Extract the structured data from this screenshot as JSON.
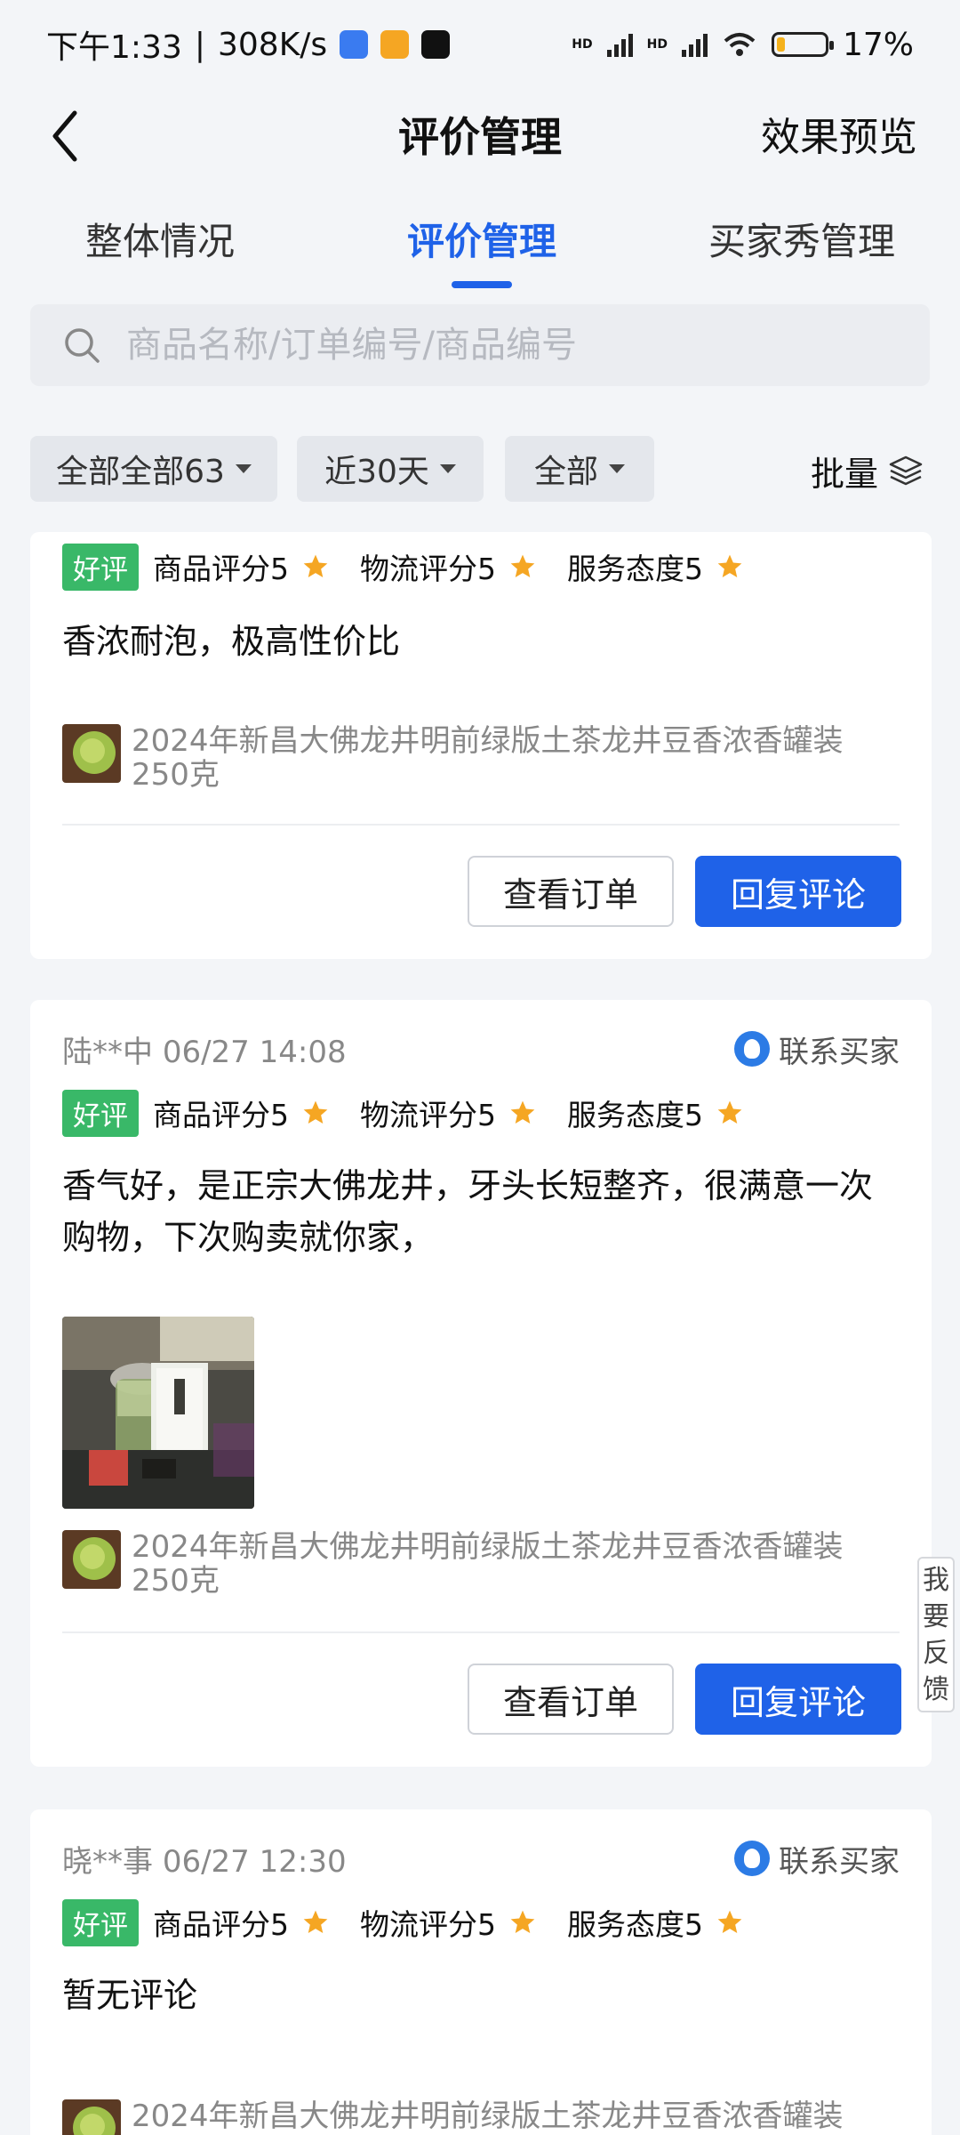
{
  "status_bar": {
    "time": "下午1:33",
    "speed": "308K/s",
    "battery": "17%",
    "battery_level": 0.17,
    "signal_label_1": "HD",
    "signal_label_2": "HD"
  },
  "header": {
    "title": "评价管理",
    "preview": "效果预览"
  },
  "tabs": [
    {
      "label": "整体情况",
      "active": false
    },
    {
      "label": "评价管理",
      "active": true
    },
    {
      "label": "买家秀管理",
      "active": false
    }
  ],
  "search": {
    "placeholder": "商品名称/订单编号/商品编号"
  },
  "filters": {
    "type": "全部全部63",
    "period": "近30天",
    "status": "全部",
    "batch": "批量"
  },
  "reviews": [
    {
      "buyer": "",
      "time": "",
      "contact": "",
      "badge": "好评",
      "rating_product": "商品评分5",
      "rating_logistics": "物流评分5",
      "rating_service": "服务态度5",
      "text": "香浓耐泡，极高性价比",
      "product_name": "2024年新昌大佛龙井明前绿版土茶龙井豆香浓香罐装250克",
      "view_order": "查看订单",
      "reply": "回复评论"
    },
    {
      "buyer": "陆**中",
      "time": "06/27 14:08",
      "contact": "联系买家",
      "badge": "好评",
      "rating_product": "商品评分5",
      "rating_logistics": "物流评分5",
      "rating_service": "服务态度5",
      "text": "香气好，是正宗大佛龙井，牙头长短整齐，很满意一次购物，下次购卖就你家，",
      "product_name": "2024年新昌大佛龙井明前绿版土茶龙井豆香浓香罐装250克",
      "view_order": "查看订单",
      "reply": "回复评论"
    },
    {
      "buyer": "晓**事",
      "time": "06/27 12:30",
      "contact": "联系买家",
      "badge": "好评",
      "rating_product": "商品评分5",
      "rating_logistics": "物流评分5",
      "rating_service": "服务态度5",
      "text": "暂无评论",
      "product_name": "2024年新昌大佛龙井明前绿版土茶龙井豆香浓香罐装"
    }
  ],
  "feedback": {
    "line1": "我",
    "line2": "要",
    "line3": "反",
    "line4": "馈"
  },
  "colors": {
    "accent": "#1f62e8",
    "good_badge": "#39b868",
    "star": "#f5a623",
    "background": "#f3f5f8"
  }
}
